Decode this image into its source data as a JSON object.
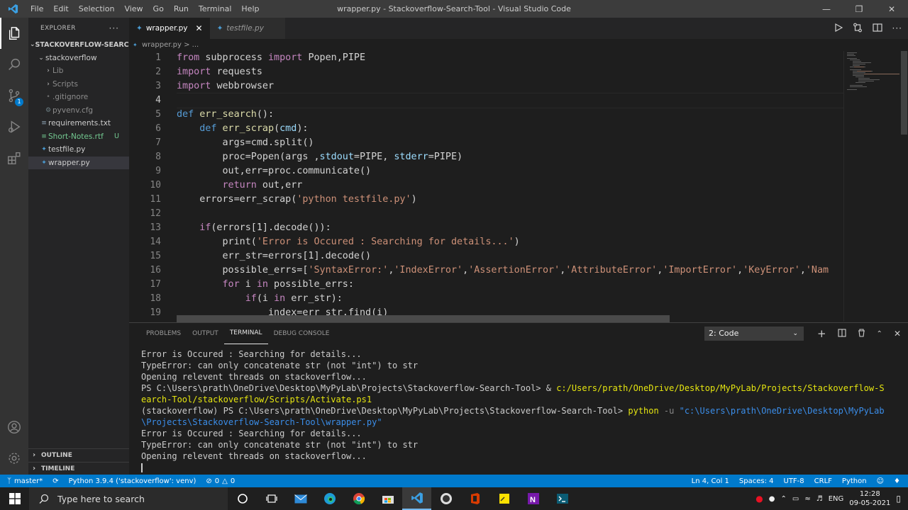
{
  "window": {
    "title": "wrapper.py - Stackoverflow-Search-Tool - Visual Studio Code",
    "menu": [
      "File",
      "Edit",
      "Selection",
      "View",
      "Go",
      "Run",
      "Terminal",
      "Help"
    ]
  },
  "explorer": {
    "header": "EXPLORER",
    "root": "STACKOVERFLOW-SEARCH...",
    "items": [
      {
        "label": "stackoverflow",
        "color": "#cccccc"
      },
      {
        "label": "Lib",
        "color": "#8c8c8c"
      },
      {
        "label": "Scripts",
        "color": "#8c8c8c"
      },
      {
        "label": ".gitignore",
        "color": "#8c8c8c"
      },
      {
        "label": "pyvenv.cfg",
        "color": "#8c8c8c"
      },
      {
        "label": "requirements.txt",
        "color": "#cccccc"
      },
      {
        "label": "Short-Notes.rtf",
        "color": "#73c991",
        "badge": "U"
      },
      {
        "label": "testfile.py",
        "color": "#cccccc"
      },
      {
        "label": "wrapper.py",
        "color": "#cccccc"
      }
    ],
    "outline": "OUTLINE",
    "timeline": "TIMELINE"
  },
  "tabs": [
    {
      "label": "wrapper.py",
      "active": true
    },
    {
      "label": "testfile.py",
      "active": false
    }
  ],
  "breadcrumb": "wrapper.py > ...",
  "editor": {
    "line_numbers": [
      "1",
      "2",
      "3",
      "4",
      "5",
      "6",
      "7",
      "8",
      "9",
      "10",
      "11",
      "12",
      "13",
      "14",
      "15",
      "16",
      "17",
      "18",
      "19"
    ],
    "current_line": 4
  },
  "panel": {
    "tabs": [
      "PROBLEMS",
      "OUTPUT",
      "TERMINAL",
      "DEBUG CONSOLE"
    ],
    "active_tab": "TERMINAL",
    "terminal_select": "2: Code"
  },
  "terminal_lines": {
    "l1": "Error is Occured : Searching for details...",
    "l2": "TypeError: can only concatenate str (not \"int\") to str",
    "l3": "Opening relevent threads on stackoverflow...",
    "l4a": "PS C:\\Users\\prath\\OneDrive\\Desktop\\MyPyLab\\Projects\\Stackoverflow-Search-Tool> & ",
    "l4b": "c:/Users/prath/OneDrive/Desktop/MyPyLab/Projects/Stackoverflow-S",
    "l5": "earch-Tool/stackoverflow/Scripts/Activate.ps1",
    "l6a": "(stackoverflow) PS C:\\Users\\prath\\OneDrive\\Desktop\\MyPyLab\\Projects\\Stackoverflow-Search-Tool> ",
    "l6b": "python",
    "l6c": " -u ",
    "l6d": "\"c:\\Users\\prath\\OneDrive\\Desktop\\MyPyLab",
    "l7": "\\Projects\\Stackoverflow-Search-Tool\\wrapper.py\"",
    "l8": "Error is Occured : Searching for details...",
    "l9": "TypeError: can only concatenate str (not \"int\") to str",
    "l10": "Opening relevent threads on stackoverflow..."
  },
  "statusbar": {
    "branch": "master*",
    "python": "Python 3.9.4 ('stackoverflow': venv)",
    "problems": "0",
    "warnings": "0",
    "position": "Ln 4, Col 1",
    "spaces": "Spaces: 4",
    "encoding": "UTF-8",
    "eol": "CRLF",
    "language": "Python"
  },
  "taskbar": {
    "search_placeholder": "Type here to search",
    "lang": "ENG",
    "time": "12:28",
    "date": "09-05-2021"
  },
  "colors": {
    "accent": "#007acc",
    "keyword": "#c586c0",
    "def": "#569cd6",
    "function": "#dcdcaa",
    "string": "#ce9178",
    "variable": "#9cdcfe"
  }
}
